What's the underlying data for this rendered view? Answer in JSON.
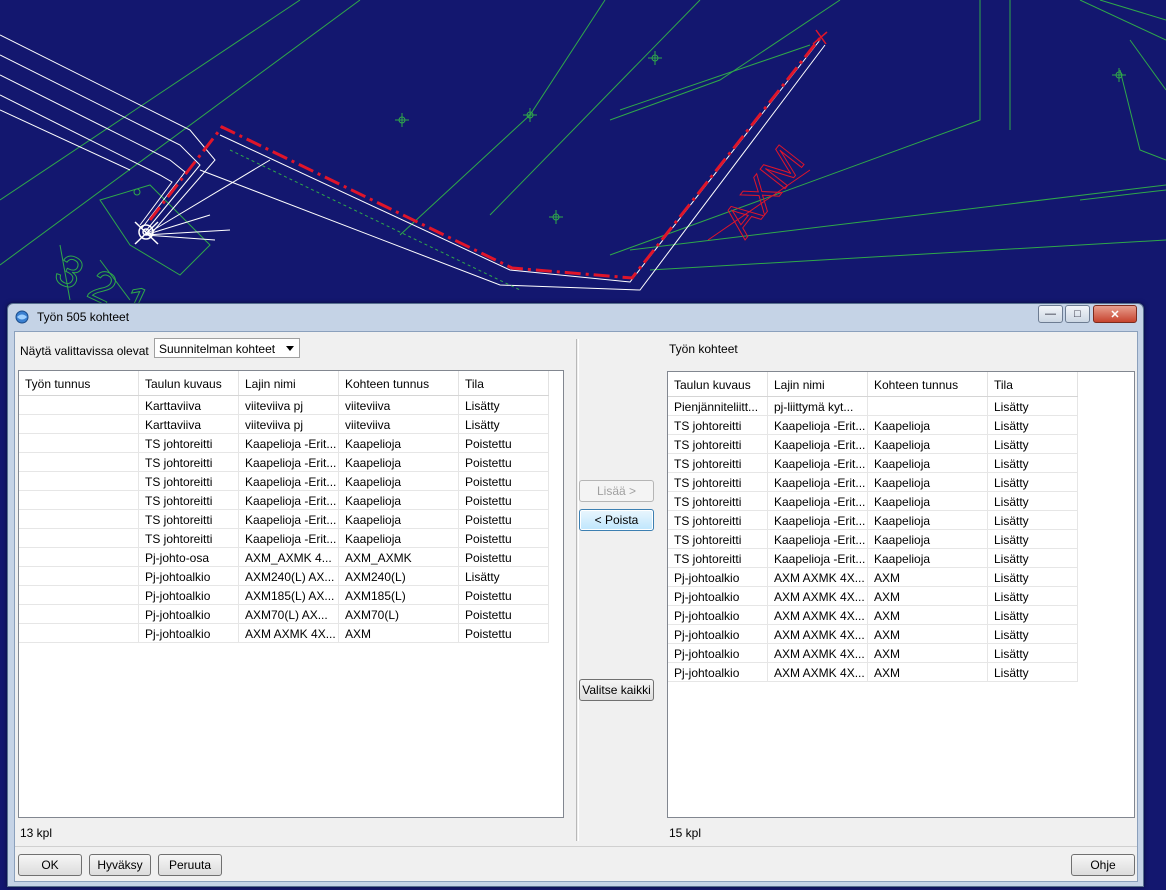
{
  "map": {
    "annotations": [
      "AXM",
      "3 2 1"
    ],
    "colors": {
      "background": "#13176f",
      "cable": "#e0152a",
      "parcel": "#2fa84a",
      "road": "#ffffff"
    }
  },
  "window": {
    "title": "Työn 505 kohteet",
    "icon": "app-icon",
    "controls": {
      "minimize": "—",
      "maximize": "□",
      "close": "✕"
    }
  },
  "left": {
    "filter_label": "Näytä valittavissa olevat",
    "filter_value": "Suunnitelman kohteet",
    "columns": [
      "Työn tunnus",
      "Taulun kuvaus",
      "Lajin nimi",
      "Kohteen tunnus",
      "Tila"
    ],
    "rows": [
      [
        "",
        "Karttaviiva",
        "viiteviiva pj",
        "viiteviiva",
        "Lisätty"
      ],
      [
        "",
        "Karttaviiva",
        "viiteviiva pj",
        "viiteviiva",
        "Lisätty"
      ],
      [
        "",
        "TS johtoreitti",
        "Kaapelioja -Erit...",
        "Kaapelioja",
        "Poistettu"
      ],
      [
        "",
        "TS johtoreitti",
        "Kaapelioja -Erit...",
        "Kaapelioja",
        "Poistettu"
      ],
      [
        "",
        "TS johtoreitti",
        "Kaapelioja -Erit...",
        "Kaapelioja",
        "Poistettu"
      ],
      [
        "",
        "TS johtoreitti",
        "Kaapelioja -Erit...",
        "Kaapelioja",
        "Poistettu"
      ],
      [
        "",
        "TS johtoreitti",
        "Kaapelioja -Erit...",
        "Kaapelioja",
        "Poistettu"
      ],
      [
        "",
        "TS johtoreitti",
        "Kaapelioja -Erit...",
        "Kaapelioja",
        "Poistettu"
      ],
      [
        "",
        "Pj-johto-osa",
        "AXM_AXMK 4...",
        "AXM_AXMK",
        "Poistettu"
      ],
      [
        "",
        "Pj-johtoalkio",
        "AXM240(L) AX...",
        "AXM240(L)",
        "Lisätty"
      ],
      [
        "",
        "Pj-johtoalkio",
        "AXM185(L) AX...",
        "AXM185(L)",
        "Poistettu"
      ],
      [
        "",
        "Pj-johtoalkio",
        "AXM70(L) AX...",
        "AXM70(L)",
        "Poistettu"
      ],
      [
        "",
        "Pj-johtoalkio",
        "AXM AXMK 4X...",
        "AXM",
        "Poistettu"
      ]
    ],
    "count": "13 kpl"
  },
  "middle": {
    "add_label": "Lisää >",
    "remove_label": "< Poista",
    "select_all_label": "Valitse kaikki"
  },
  "right": {
    "heading": "Työn kohteet",
    "columns": [
      "Taulun kuvaus",
      "Lajin nimi",
      "Kohteen tunnus",
      "Tila"
    ],
    "rows": [
      [
        "Pienjänniteliitt...",
        "pj-liittymä kyt...",
        "",
        "Lisätty"
      ],
      [
        "TS johtoreitti",
        "Kaapelioja -Erit...",
        "Kaapelioja",
        "Lisätty"
      ],
      [
        "TS johtoreitti",
        "Kaapelioja -Erit...",
        "Kaapelioja",
        "Lisätty"
      ],
      [
        "TS johtoreitti",
        "Kaapelioja -Erit...",
        "Kaapelioja",
        "Lisätty"
      ],
      [
        "TS johtoreitti",
        "Kaapelioja -Erit...",
        "Kaapelioja",
        "Lisätty"
      ],
      [
        "TS johtoreitti",
        "Kaapelioja -Erit...",
        "Kaapelioja",
        "Lisätty"
      ],
      [
        "TS johtoreitti",
        "Kaapelioja -Erit...",
        "Kaapelioja",
        "Lisätty"
      ],
      [
        "TS johtoreitti",
        "Kaapelioja -Erit...",
        "Kaapelioja",
        "Lisätty"
      ],
      [
        "TS johtoreitti",
        "Kaapelioja -Erit...",
        "Kaapelioja",
        "Lisätty"
      ],
      [
        "Pj-johtoalkio",
        "AXM AXMK 4X...",
        "AXM",
        "Lisätty"
      ],
      [
        "Pj-johtoalkio",
        "AXM AXMK 4X...",
        "AXM",
        "Lisätty"
      ],
      [
        "Pj-johtoalkio",
        "AXM AXMK 4X...",
        "AXM",
        "Lisätty"
      ],
      [
        "Pj-johtoalkio",
        "AXM AXMK 4X...",
        "AXM",
        "Lisätty"
      ],
      [
        "Pj-johtoalkio",
        "AXM AXMK 4X...",
        "AXM",
        "Lisätty"
      ],
      [
        "Pj-johtoalkio",
        "AXM AXMK 4X...",
        "AXM",
        "Lisätty"
      ]
    ],
    "count": "15 kpl"
  },
  "footer": {
    "ok_label": "OK",
    "accept_label": "Hyväksy",
    "cancel_label": "Peruuta",
    "help_label": "Ohje"
  }
}
